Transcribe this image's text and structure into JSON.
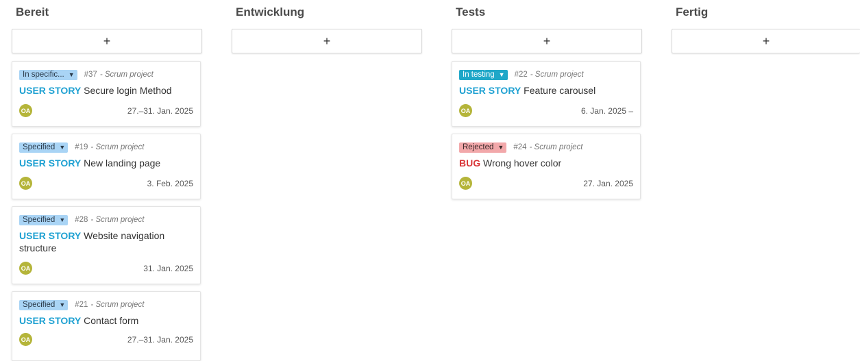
{
  "board": {
    "columns": [
      {
        "title": "Bereit",
        "add_label": "+",
        "cards": [
          {
            "status": "In specific...",
            "number": "#37",
            "project": "- Scrum project",
            "type": "USER STORY",
            "subject": "Secure login Method",
            "assignee": "OA",
            "dates": "27.–31. Jan. 2025"
          },
          {
            "status": "Specified",
            "number": "#19",
            "project": "- Scrum project",
            "type": "USER STORY",
            "subject": "New landing page",
            "assignee": "OA",
            "dates": "3. Feb. 2025"
          },
          {
            "status": "Specified",
            "number": "#28",
            "project": "- Scrum project",
            "type": "USER STORY",
            "subject": "Website navigation structure",
            "assignee": "OA",
            "dates": "31. Jan. 2025"
          },
          {
            "status": "Specified",
            "number": "#21",
            "project": "- Scrum project",
            "type": "USER STORY",
            "subject": "Contact form",
            "assignee": "OA",
            "dates": "27.–31. Jan. 2025"
          }
        ]
      },
      {
        "title": "Entwicklung",
        "add_label": "+",
        "cards": []
      },
      {
        "title": "Tests",
        "add_label": "+",
        "cards": [
          {
            "status": "In testing",
            "number": "#22",
            "project": "- Scrum project",
            "type": "USER STORY",
            "subject": "Feature carousel",
            "assignee": "OA",
            "dates": "6. Jan. 2025 –"
          },
          {
            "status": "Rejected",
            "number": "#24",
            "project": "- Scrum project",
            "type": "BUG",
            "subject": "Wrong hover color",
            "assignee": "OA",
            "dates": "27. Jan. 2025"
          }
        ]
      },
      {
        "title": "Fertig",
        "add_label": "+",
        "cards": []
      }
    ]
  },
  "colors": {
    "status_specified": "#a9d4f5",
    "status_testing": "#1fa7c8",
    "status_rejected": "#f2a8aa",
    "type_story": "#1fa1d2",
    "type_bug": "#d9373a",
    "avatar": "#b5b53a"
  },
  "icons": {
    "status_dropdown": "caret-down-icon",
    "add": "plus-icon"
  }
}
